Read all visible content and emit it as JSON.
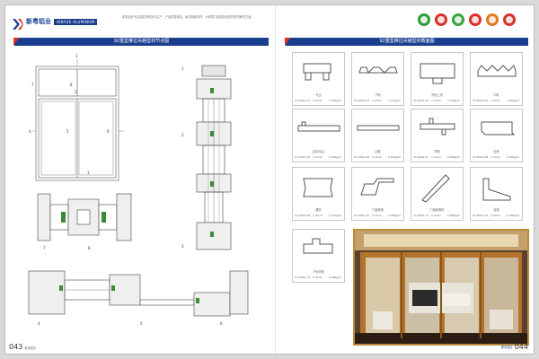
{
  "header": {
    "brand_cn": "新粤铝业",
    "brand_en": "XINYUE ALUMINUM",
    "intro": "新粤铝业专注铝型材研发与生产，产品质量稳定，款式新颖多样，为家居门窗提供优质的型材解决方案。",
    "badges": [
      {
        "name": "badge-1",
        "color": "#2e9d3a"
      },
      {
        "name": "badge-2",
        "color": "#d8312b"
      },
      {
        "name": "badge-3",
        "color": "#35a640"
      },
      {
        "name": "badge-4",
        "color": "#d8312b"
      },
      {
        "name": "badge-5",
        "color": "#e07a1f"
      },
      {
        "name": "badge-6",
        "color": "#d8312b"
      }
    ]
  },
  "left_page": {
    "title": "92重型推拉吊趟型材节点图",
    "window_numbers": [
      "1",
      "2",
      "3",
      "4",
      "5",
      "6",
      "7",
      "8"
    ],
    "section_numbers": [
      "1",
      "2",
      "3"
    ],
    "detail_numbers": [
      "7",
      "8"
    ],
    "bottom_numbers": [
      "4",
      "5",
      "6"
    ],
    "page_number": "043",
    "page_label": "新粤铝业"
  },
  "right_page": {
    "title": "92重型推拉吊趟型材截面图",
    "page_number": "044",
    "page_label": "新粤铝业",
    "profiles": [
      {
        "name": "光企",
        "code": "XY-9292-01",
        "thick": "1.4mm",
        "weight": "1.35kg/m"
      },
      {
        "name": "下轨",
        "code": "XY-9292-02",
        "thick": "1.4mm",
        "weight": "1.12kg/m"
      },
      {
        "name": "吊轨上滑",
        "code": "XY-9292-03",
        "thick": "1.4mm",
        "weight": "1.79kg/m"
      },
      {
        "name": "中轨",
        "code": "XY-9292-04",
        "thick": "1.4mm",
        "weight": "1.05kg/m"
      },
      {
        "name": "边封/勾企",
        "code": "XY-9292-05",
        "thick": "1.4mm",
        "weight": "0.56kg/m"
      },
      {
        "name": "边框",
        "code": "XY-9292-06",
        "thick": "1.4mm",
        "weight": "0.81kg/m"
      },
      {
        "name": "拼框",
        "code": "XY-9292-07",
        "thick": "1.4mm",
        "weight": "0.90kg/m"
      },
      {
        "name": "压条",
        "code": "XY-9292-08",
        "thick": "1.4mm",
        "weight": "0.24kg/m"
      },
      {
        "name": "腰枋",
        "code": "XY-9292-09",
        "thick": "1.4mm",
        "weight": "0.71kg/m"
      },
      {
        "name": "门窗转角",
        "code": "XY-9292-10",
        "thick": "1.4mm",
        "weight": "0.98kg/m"
      },
      {
        "name": "门窗转角料",
        "code": "XY-9292-11",
        "thick": "1.4mm",
        "weight": "0.69kg/m"
      },
      {
        "name": "挂钩",
        "code": "XY-9292-12",
        "thick": "1.4mm",
        "weight": "0.43kg/m"
      },
      {
        "name": "下轨滑轨",
        "code": "XY-9292-13",
        "thick": "1.4mm",
        "weight": "0.46kg/m"
      }
    ]
  }
}
